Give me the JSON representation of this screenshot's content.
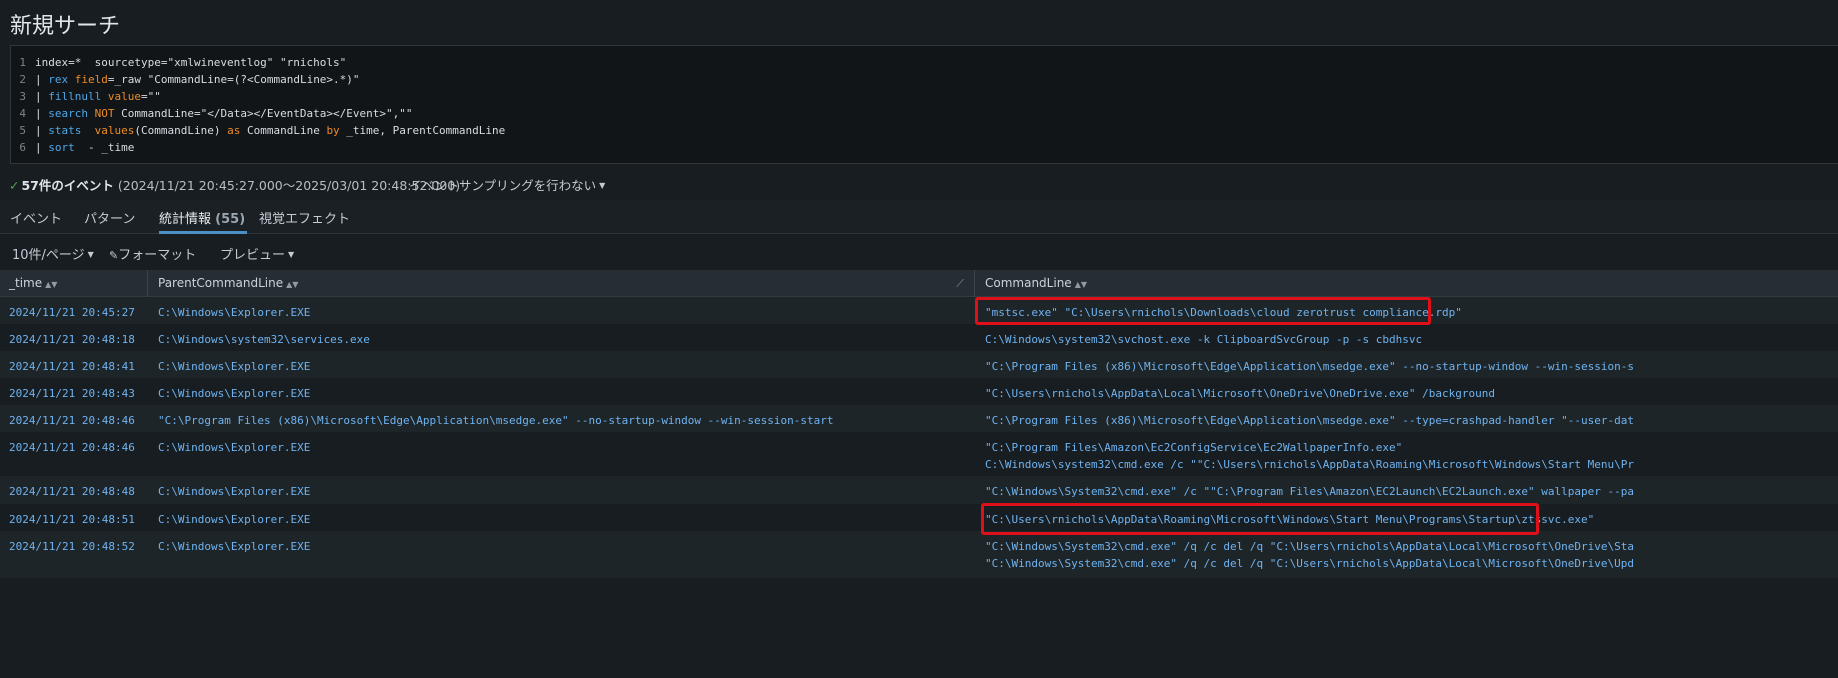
{
  "page": {
    "title": "新規サーチ"
  },
  "query": {
    "lines": [
      {
        "num": "1",
        "text": "index=*  sourcetype=\"xmlwineventlog\" \"rnichols\""
      },
      {
        "num": "2",
        "text": "| rex field=_raw \"CommandLine=(?<CommandLine>.*)\""
      },
      {
        "num": "3",
        "text": "| fillnull value=\"\""
      },
      {
        "num": "4",
        "text": "| search NOT CommandLine=\"</Data></EventData></Event>\",\"\""
      },
      {
        "num": "5",
        "text": "| stats  values(CommandLine) as CommandLine by _time, ParentCommandLine"
      },
      {
        "num": "6",
        "text": "| sort  - _time"
      }
    ]
  },
  "status": {
    "count": "57件のイベント",
    "range": "(2024/11/21 20:45:27.000～2025/03/01 20:48:52.000)",
    "sampling": "イベントサンプリングを行わない"
  },
  "tabs": [
    {
      "label": "イベント"
    },
    {
      "label": "パターン"
    },
    {
      "label": "統計情報",
      "badge": "(55)"
    },
    {
      "label": "視覚エフェクト"
    }
  ],
  "toolbar": {
    "per_page": "10件/ページ",
    "format": "フォーマット",
    "preview": "プレビュー"
  },
  "table": {
    "columns": [
      "_time",
      "ParentCommandLine",
      "CommandLine"
    ],
    "rows": [
      {
        "time": "2024/11/21 20:45:27",
        "parent": "C:\\Windows\\Explorer.EXE",
        "cmd": [
          "\"mstsc.exe\" \"C:\\Users\\rnichols\\Downloads\\cloud zerotrust compliance.rdp\""
        ]
      },
      {
        "time": "2024/11/21 20:48:18",
        "parent": "C:\\Windows\\system32\\services.exe",
        "cmd": [
          "C:\\Windows\\system32\\svchost.exe -k ClipboardSvcGroup -p -s cbdhsvc"
        ]
      },
      {
        "time": "2024/11/21 20:48:41",
        "parent": "C:\\Windows\\Explorer.EXE",
        "cmd": [
          "\"C:\\Program Files (x86)\\Microsoft\\Edge\\Application\\msedge.exe\" --no-startup-window --win-session-s"
        ]
      },
      {
        "time": "2024/11/21 20:48:43",
        "parent": "C:\\Windows\\Explorer.EXE",
        "cmd": [
          "\"C:\\Users\\rnichols\\AppData\\Local\\Microsoft\\OneDrive\\OneDrive.exe\" /background"
        ]
      },
      {
        "time": "2024/11/21 20:48:46",
        "parent": "\"C:\\Program Files (x86)\\Microsoft\\Edge\\Application\\msedge.exe\" --no-startup-window --win-session-start",
        "cmd": [
          "\"C:\\Program Files (x86)\\Microsoft\\Edge\\Application\\msedge.exe\" --type=crashpad-handler \"--user-dat"
        ]
      },
      {
        "time": "2024/11/21 20:48:46",
        "parent": "C:\\Windows\\Explorer.EXE",
        "cmd": [
          "\"C:\\Program Files\\Amazon\\Ec2ConfigService\\Ec2WallpaperInfo.exe\"",
          "C:\\Windows\\system32\\cmd.exe /c \"\"C:\\Users\\rnichols\\AppData\\Roaming\\Microsoft\\Windows\\Start Menu\\Pr"
        ]
      },
      {
        "time": "2024/11/21 20:48:48",
        "parent": "C:\\Windows\\Explorer.EXE",
        "cmd": [
          "\"C:\\Windows\\System32\\cmd.exe\" /c \"\"C:\\Program Files\\Amazon\\EC2Launch\\EC2Launch.exe\" wallpaper --pa"
        ]
      },
      {
        "time": "2024/11/21 20:48:51",
        "parent": "C:\\Windows\\Explorer.EXE",
        "cmd": [
          "\"C:\\Users\\rnichols\\AppData\\Roaming\\Microsoft\\Windows\\Start Menu\\Programs\\Startup\\ztssvc.exe\""
        ]
      },
      {
        "time": "2024/11/21 20:48:52",
        "parent": "C:\\Windows\\Explorer.EXE",
        "cmd": [
          "\"C:\\Windows\\System32\\cmd.exe\" /q /c del /q \"C:\\Users\\rnichols\\AppData\\Local\\Microsoft\\OneDrive\\Sta",
          "\"C:\\Windows\\System32\\cmd.exe\" /q /c del /q \"C:\\Users\\rnichols\\AppData\\Local\\Microsoft\\OneDrive\\Upd"
        ]
      }
    ]
  },
  "colors": {
    "highlight": "#e0101a",
    "accent": "#4c8fc4",
    "link": "#6fb3f0"
  }
}
